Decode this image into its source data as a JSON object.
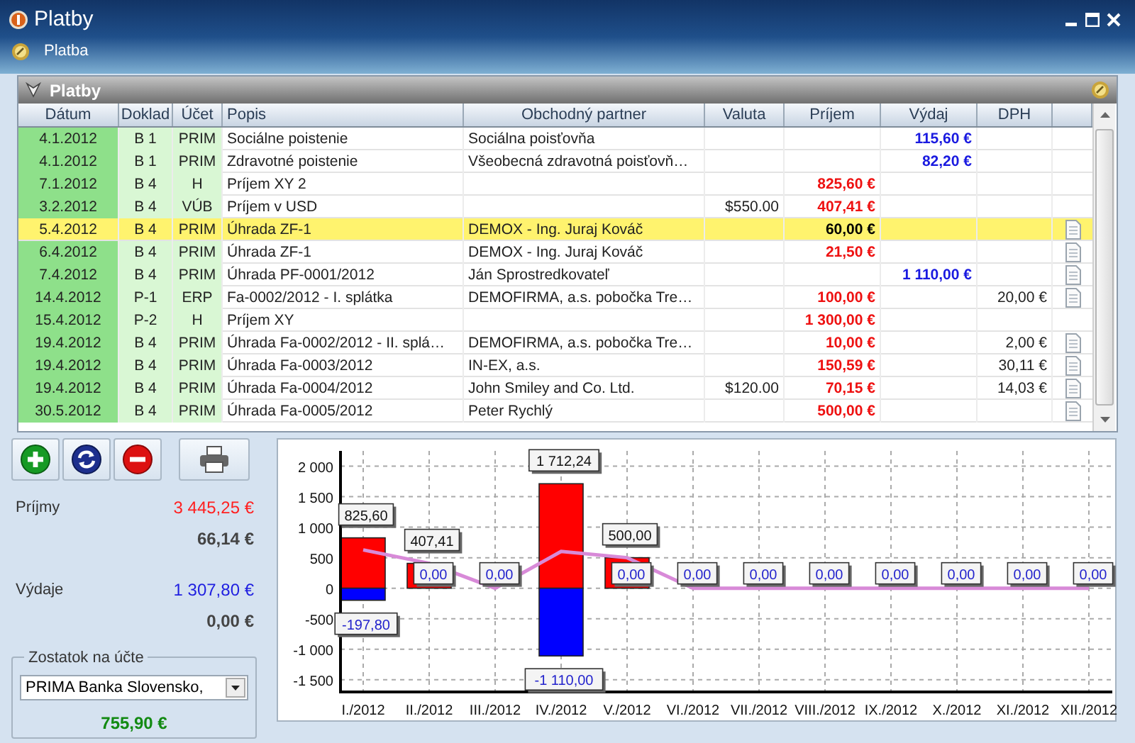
{
  "window": {
    "title": "Platby"
  },
  "toolbar": {
    "label": "Platba"
  },
  "grid": {
    "title": "Platby",
    "columns": [
      "Dátum",
      "Doklad",
      "Účet",
      "Popis",
      "Obchodný partner",
      "Valuta",
      "Príjem",
      "Výdaj",
      "DPH"
    ],
    "rows": [
      {
        "date": "4.1.2012",
        "doc": "B 1",
        "account": "PRIM",
        "description": "Sociálne poistenie",
        "partner": "Sociálna poisťovňa",
        "expense": "115,60 €",
        "attachment": false,
        "selected": false
      },
      {
        "date": "4.1.2012",
        "doc": "B 1",
        "account": "PRIM",
        "description": "Zdravotné poistenie",
        "partner": "Všeobecná zdravotná poisťovň…",
        "expense": "82,20 €",
        "attachment": false,
        "selected": false
      },
      {
        "date": "7.1.2012",
        "doc": "B 4",
        "account": "H",
        "description": "Príjem XY 2",
        "income": "825,60 €",
        "attachment": false,
        "selected": false
      },
      {
        "date": "3.2.2012",
        "doc": "B 4",
        "account": "VÚB",
        "description": "Príjem v USD",
        "currency": "$550.00",
        "income": "407,41 €",
        "attachment": false,
        "selected": false
      },
      {
        "date": "5.4.2012",
        "doc": "B 4",
        "account": "PRIM",
        "description": "Úhrada ZF-1",
        "partner": "DEMOX - Ing. Juraj Kováč",
        "income": "60,00 €",
        "attachment": true,
        "selected": true
      },
      {
        "date": "6.4.2012",
        "doc": "B 4",
        "account": "PRIM",
        "description": "Úhrada ZF-1",
        "partner": "DEMOX - Ing. Juraj Kováč",
        "income": "21,50 €",
        "attachment": true,
        "selected": false
      },
      {
        "date": "7.4.2012",
        "doc": "B 4",
        "account": "PRIM",
        "description": "Úhrada PF-0001/2012",
        "partner": "Ján Sprostredkovateľ",
        "expense": "1 110,00 €",
        "attachment": true,
        "selected": false
      },
      {
        "date": "14.4.2012",
        "doc": "P-1",
        "account": "ERP",
        "description": "Fa-0002/2012 - I. splátka",
        "partner": "DEMOFIRMA, a.s. pobočka Tre…",
        "income": "100,00 €",
        "vat": "20,00 €",
        "attachment": true,
        "selected": false
      },
      {
        "date": "15.4.2012",
        "doc": "P-2",
        "account": "H",
        "description": "Príjem XY",
        "income": "1 300,00 €",
        "attachment": false,
        "selected": false
      },
      {
        "date": "19.4.2012",
        "doc": "B 4",
        "account": "PRIM",
        "description": "Úhrada Fa-0002/2012 - II. splá…",
        "partner": "DEMOFIRMA, a.s. pobočka Tre…",
        "income": "10,00 €",
        "vat": "2,00 €",
        "attachment": true,
        "selected": false
      },
      {
        "date": "19.4.2012",
        "doc": "B 4",
        "account": "PRIM",
        "description": "Úhrada Fa-0003/2012",
        "partner": "IN-EX, a.s.",
        "income": "150,59 €",
        "vat": "30,11 €",
        "attachment": true,
        "selected": false
      },
      {
        "date": "19.4.2012",
        "doc": "B 4",
        "account": "PRIM",
        "description": "Úhrada Fa-0004/2012",
        "partner": "John Smiley and Co. Ltd.",
        "currency": "$120.00",
        "income": "70,15 €",
        "vat": "14,03 €",
        "attachment": true,
        "selected": false
      },
      {
        "date": "30.5.2012",
        "doc": "B 4",
        "account": "PRIM",
        "description": "Úhrada Fa-0005/2012",
        "partner": "Peter Rychlý",
        "income": "500,00 €",
        "attachment": true,
        "selected": false
      }
    ]
  },
  "summary": {
    "income_label": "Príjmy",
    "income_total": "3 445,25 €",
    "income_vat": "66,14 €",
    "expense_label": "Výdaje",
    "expense_total": "1 307,80 €",
    "expense_vat": "0,00 €",
    "balance": {
      "title": "Zostatok na účte",
      "account": "PRIMA Banka Slovensko,",
      "amount": "755,90 €"
    }
  },
  "chart": {
    "chart_data": {
      "type": "bar",
      "grid": true,
      "categories": [
        "I./2012",
        "II./2012",
        "III./2012",
        "IV./2012",
        "V./2012",
        "VI./2012",
        "VII./2012",
        "VIII./2012",
        "IX./2012",
        "X./2012",
        "XI./2012",
        "XII./2012"
      ],
      "ylim": [
        -1700,
        2250
      ],
      "yticks": [
        {
          "value": 2000,
          "label": "2 000"
        },
        {
          "value": 1500,
          "label": "1 500"
        },
        {
          "value": 1000,
          "label": "1 000"
        },
        {
          "value": 500,
          "label": "500"
        },
        {
          "value": 0,
          "label": "0"
        },
        {
          "value": -500,
          "label": "-500"
        },
        {
          "value": -1000,
          "label": "-1 000"
        },
        {
          "value": -1500,
          "label": "-1 500"
        }
      ],
      "series": [
        {
          "type": "bar",
          "color": "#ff0000",
          "values": [
            825.6,
            407.41,
            0,
            1712.24,
            500,
            0,
            0,
            0,
            0,
            0,
            0,
            0
          ],
          "value_labels": [
            "825,60",
            "407,41",
            null,
            "1 712,24",
            "500,00",
            null,
            null,
            null,
            null,
            null,
            null,
            null
          ]
        },
        {
          "type": "bar",
          "color": "#0000ff",
          "values": [
            -197.8,
            0,
            0,
            -1110,
            0,
            0,
            0,
            0,
            0,
            0,
            0,
            0
          ],
          "value_labels": [
            "-197,80",
            "0,00",
            "0,00",
            "-1 110,00",
            "0,00",
            "0,00",
            "0,00",
            "0,00",
            "0,00",
            "0,00",
            "0,00",
            "0,00"
          ]
        },
        {
          "type": "line",
          "color": "#d88ad8",
          "values": [
            627.8,
            407.41,
            0,
            602.24,
            500,
            0,
            0,
            0,
            0,
            0,
            0,
            0
          ]
        }
      ]
    }
  }
}
